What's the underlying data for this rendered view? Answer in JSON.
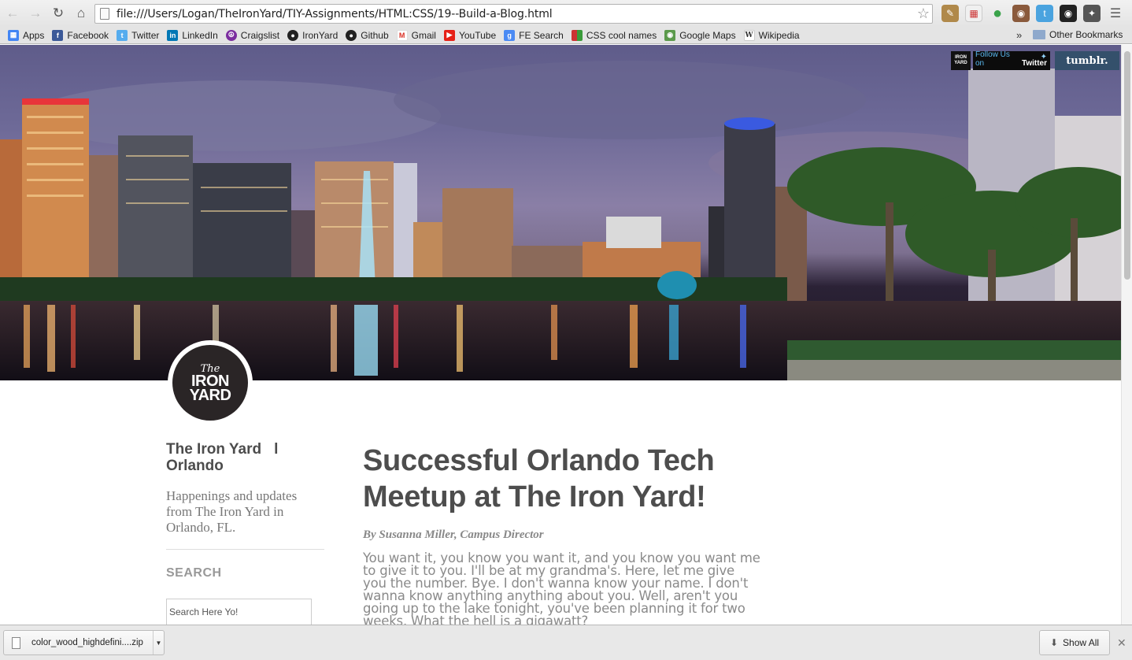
{
  "browser": {
    "url": "file:///Users/Logan/TheIronYard/TIY-Assignments/HTML:CSS/19--Build-a-Blog.html",
    "icons": {
      "back": "arrow-left-icon",
      "forward": "arrow-right-icon",
      "reload": "reload-icon",
      "home": "home-icon",
      "star": "star-icon",
      "menu": "hamburger-menu-icon"
    }
  },
  "bookmarks": {
    "items": [
      {
        "label": "Apps",
        "icon": "apps-grid-icon",
        "color": "#4285f4"
      },
      {
        "label": "Facebook",
        "icon": "facebook-icon",
        "color": "#3b5998"
      },
      {
        "label": "Twitter",
        "icon": "twitter-icon",
        "color": "#55acee"
      },
      {
        "label": "LinkedIn",
        "icon": "linkedin-icon",
        "color": "#0077b5"
      },
      {
        "label": "Craigslist",
        "icon": "peace-icon",
        "color": "#7b2d9f"
      },
      {
        "label": "IronYard",
        "icon": "github-icon",
        "color": "#222222"
      },
      {
        "label": "Github",
        "icon": "github-icon",
        "color": "#222222"
      },
      {
        "label": "Gmail",
        "icon": "gmail-icon",
        "color": "#d93025"
      },
      {
        "label": "YouTube",
        "icon": "youtube-icon",
        "color": "#e62117"
      },
      {
        "label": "FE Search",
        "icon": "google-plus-icon",
        "color": "#4a8af4"
      },
      {
        "label": "CSS cool names",
        "icon": "color-grid-icon",
        "color": "#3a9b3a"
      },
      {
        "label": "Google Maps",
        "icon": "maps-icon",
        "color": "#5b9a4b"
      },
      {
        "label": "Wikipedia",
        "icon": "wikipedia-icon",
        "color": "#333333"
      }
    ],
    "overflow": "»",
    "other": "Other Bookmarks"
  },
  "social": {
    "iron_yard_badge": "IRON YARD",
    "follow_prefix": "Follow Us on",
    "follow_network": "Twitter",
    "tumblr": "tumblr."
  },
  "logo": {
    "line1": "The",
    "line2": "IRON",
    "line3": "YARD"
  },
  "sidebar": {
    "title_main": "The Iron Yard",
    "title_sep": "l",
    "title_city": "Orlando",
    "tagline": "Happenings and updates from The Iron Yard in Orlando, FL.",
    "search_heading": "SEARCH",
    "search_placeholder": "Search Here Yo!"
  },
  "post": {
    "title": "Successful Orlando Tech Meetup at The Iron Yard!",
    "byline": "By Susanna Miller, Campus Director",
    "body": "You want it, you know you want it, and you know you want me to give it to you. I'll be at my grandma's. Here, let me give you the number. Bye. I don't wanna know your name. I don't wanna know anything anything about you. Well, aren't you going up to the lake tonight, you've been planning it for two weeks. What the hell is a gigawatt?"
  },
  "downloads": {
    "file_name": "color_wood_highdefini....zip",
    "show_all": "Show All"
  }
}
